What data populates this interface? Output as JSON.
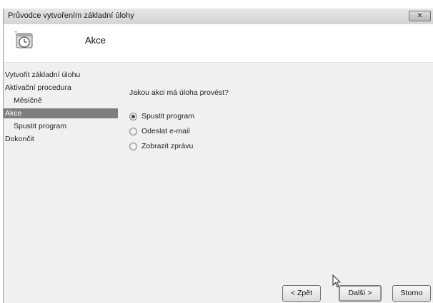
{
  "window": {
    "title": "Průvodce vytvořením základní úlohy",
    "close_label": "✕"
  },
  "header": {
    "title": "Akce",
    "icon": "task-clock-icon"
  },
  "sidebar": {
    "items": [
      {
        "label": "Vytvořit základní úlohu",
        "active": false
      },
      {
        "label": "Aktivační procedura",
        "active": false
      },
      {
        "label": "Měsíčně",
        "active": false,
        "indent": true
      },
      {
        "label": "Akce",
        "active": true
      },
      {
        "label": "Spustit program",
        "active": false,
        "indent": true
      },
      {
        "label": "Dokončit",
        "active": false
      }
    ]
  },
  "main": {
    "question": "Jakou akci má úloha provést?",
    "options": [
      {
        "label": "Spustit program",
        "checked": true
      },
      {
        "label": "Odeslat e-mail",
        "checked": false
      },
      {
        "label": "Zobrazit zprávu",
        "checked": false
      }
    ]
  },
  "footer": {
    "back_label": "< Zpět",
    "next_label": "Další >",
    "cancel_label": "Storno"
  }
}
